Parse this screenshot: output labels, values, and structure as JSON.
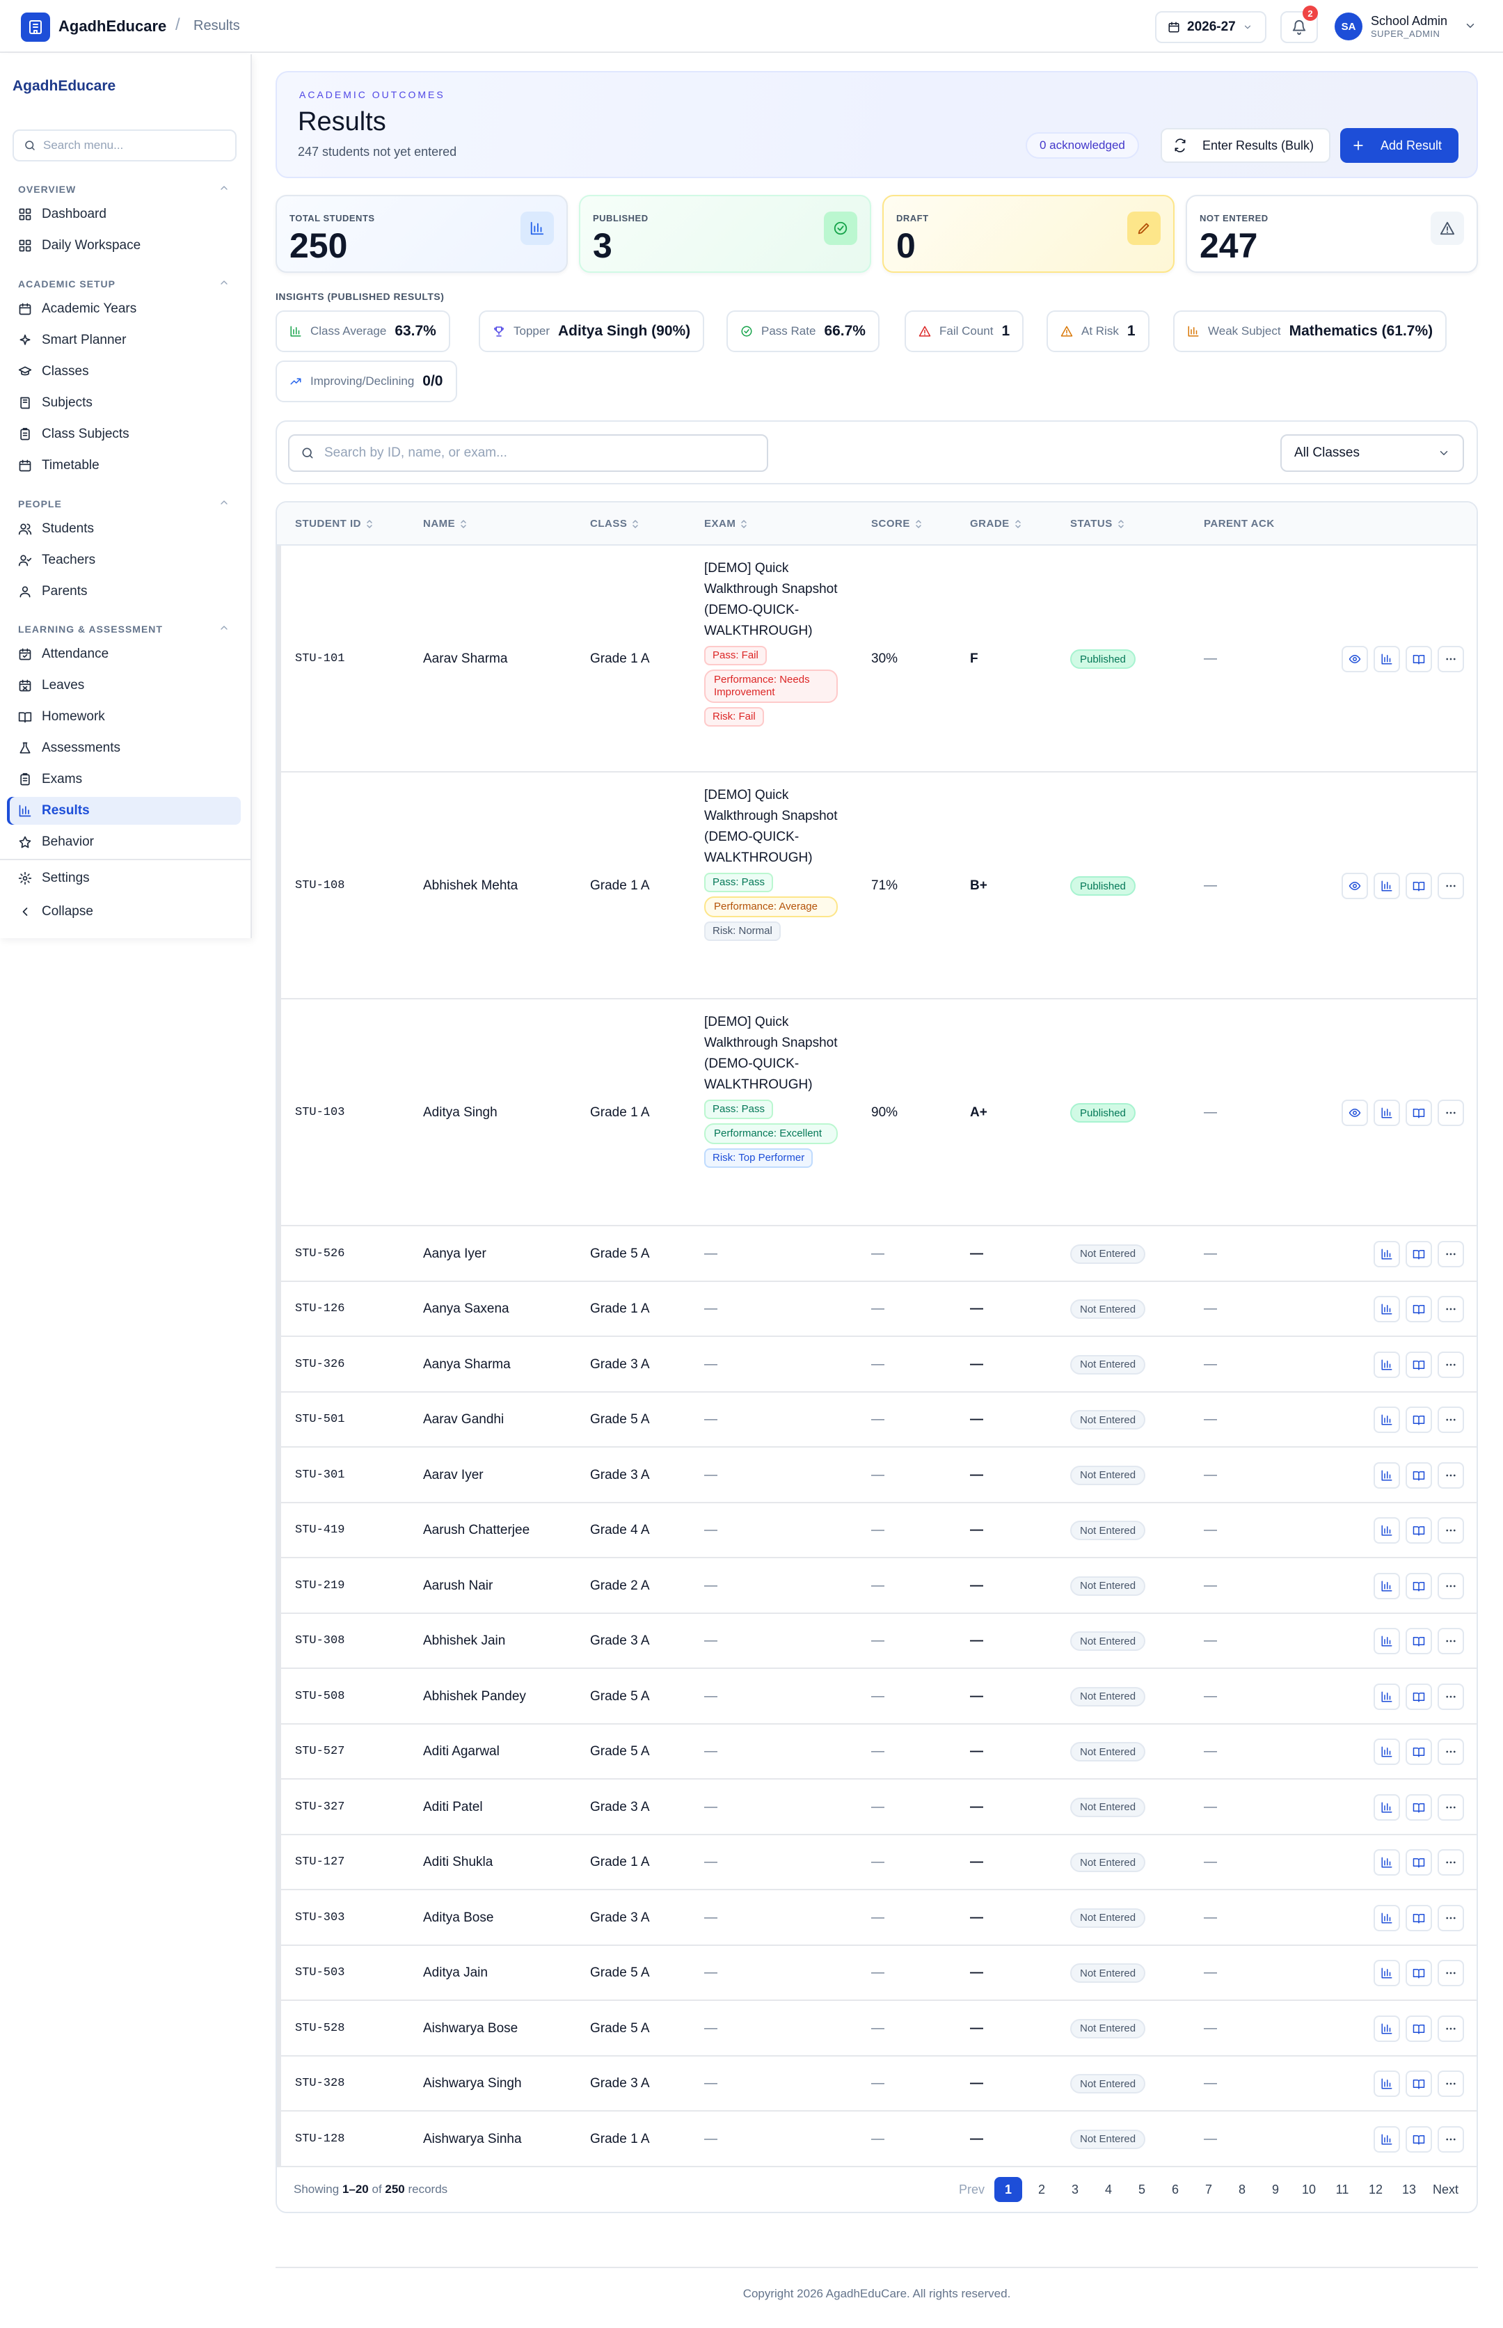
{
  "topbar": {
    "brand": "AgadhEducare",
    "breadcrumb_sep": "/",
    "breadcrumb": "Results",
    "year": "2026-27",
    "notification_count": "2",
    "avatar_initials": "SA",
    "user_name": "School Admin",
    "user_role": "SUPER_ADMIN"
  },
  "sidebar": {
    "brand": "AgadhEducare",
    "search_placeholder": "Search menu...",
    "sections": [
      {
        "title": "OVERVIEW",
        "items": [
          {
            "label": "Dashboard",
            "icon": "grid-icon"
          },
          {
            "label": "Daily Workspace",
            "icon": "grid-icon"
          }
        ]
      },
      {
        "title": "ACADEMIC SETUP",
        "items": [
          {
            "label": "Academic Years",
            "icon": "calendar-icon"
          },
          {
            "label": "Smart Planner",
            "icon": "sparkle-icon"
          },
          {
            "label": "Classes",
            "icon": "graduation-cap-icon"
          },
          {
            "label": "Subjects",
            "icon": "book-icon"
          },
          {
            "label": "Class Subjects",
            "icon": "clipboard-icon"
          },
          {
            "label": "Timetable",
            "icon": "calendar-icon"
          }
        ]
      },
      {
        "title": "PEOPLE",
        "items": [
          {
            "label": "Students",
            "icon": "users-icon"
          },
          {
            "label": "Teachers",
            "icon": "user-check-icon"
          },
          {
            "label": "Parents",
            "icon": "user-icon"
          }
        ]
      },
      {
        "title": "LEARNING & ASSESSMENT",
        "items": [
          {
            "label": "Attendance",
            "icon": "calendar-check-icon"
          },
          {
            "label": "Leaves",
            "icon": "calendar-off-icon"
          },
          {
            "label": "Homework",
            "icon": "book-open-icon"
          },
          {
            "label": "Assessments",
            "icon": "flask-icon"
          },
          {
            "label": "Exams",
            "icon": "clipboard-icon"
          },
          {
            "label": "Results",
            "icon": "bar-chart-icon"
          },
          {
            "label": "Behavior",
            "icon": "star-icon"
          }
        ]
      }
    ],
    "active": "Results",
    "settings": "Settings",
    "collapse": "Collapse"
  },
  "hero": {
    "eyebrow": "ACADEMIC OUTCOMES",
    "title": "Results",
    "subtitle": "247 students not yet entered",
    "ack": "0 acknowledged",
    "bulk_button": "Enter Results (Bulk)",
    "add_button": "Add Result"
  },
  "stats": [
    {
      "label": "TOTAL STUDENTS",
      "value": "250",
      "icon": "bar-chart-icon",
      "color": "#2563eb"
    },
    {
      "label": "PUBLISHED",
      "value": "3",
      "icon": "check-circle-icon",
      "color": "#16a34a"
    },
    {
      "label": "DRAFT",
      "value": "0",
      "icon": "pencil-icon",
      "color": "#b45309"
    },
    {
      "label": "NOT ENTERED",
      "value": "247",
      "icon": "alert-triangle-icon",
      "color": "#475569"
    }
  ],
  "insights": {
    "title": "INSIGHTS (PUBLISHED RESULTS)",
    "chips": [
      {
        "label": "Class Average",
        "value": "63.7%"
      },
      {
        "label": "Topper",
        "value": "Aditya Singh (90%)"
      },
      {
        "label": "Pass Rate",
        "value": "66.7%"
      },
      {
        "label": "Fail Count",
        "value": "1"
      },
      {
        "label": "At Risk",
        "value": "1"
      },
      {
        "label": "Weak Subject",
        "value": "Mathematics (61.7%)"
      },
      {
        "label": "Improving/Declining",
        "value": "0/0"
      }
    ]
  },
  "filter": {
    "search_placeholder": "Search by ID, name, or exam...",
    "class_select": "All Classes"
  },
  "table": {
    "headers": [
      "STUDENT ID",
      "NAME",
      "CLASS",
      "EXAM",
      "SCORE",
      "GRADE",
      "STATUS",
      "PARENT ACK"
    ],
    "detailed_rows": [
      {
        "id": "STU-101",
        "name": "Aarav Sharma",
        "class": "Grade 1 A",
        "exam": "[DEMO] Quick Walkthrough Snapshot (DEMO-QUICK-WALKTHROUGH)",
        "pass": "Pass: Fail",
        "performance": "Performance: Needs Improvement",
        "risk": "Risk: Fail",
        "score": "30%",
        "grade": "F",
        "status": "Published",
        "ack": "—"
      },
      {
        "id": "STU-108",
        "name": "Abhishek Mehta",
        "class": "Grade 1 A",
        "exam": "[DEMO] Quick Walkthrough Snapshot (DEMO-QUICK-WALKTHROUGH)",
        "pass": "Pass: Pass",
        "performance": "Performance: Average",
        "risk": "Risk: Normal",
        "score": "71%",
        "grade": "B+",
        "status": "Published",
        "ack": "—"
      },
      {
        "id": "STU-103",
        "name": "Aditya Singh",
        "class": "Grade 1 A",
        "exam": "[DEMO] Quick Walkthrough Snapshot (DEMO-QUICK-WALKTHROUGH)",
        "pass": "Pass: Pass",
        "performance": "Performance: Excellent",
        "risk": "Risk: Top Performer",
        "score": "90%",
        "grade": "A+",
        "status": "Published",
        "ack": "—"
      }
    ],
    "empty_rows": [
      {
        "id": "STU-526",
        "name": "Aanya Iyer",
        "class": "Grade 5 A"
      },
      {
        "id": "STU-126",
        "name": "Aanya Saxena",
        "class": "Grade 1 A"
      },
      {
        "id": "STU-326",
        "name": "Aanya Sharma",
        "class": "Grade 3 A"
      },
      {
        "id": "STU-501",
        "name": "Aarav Gandhi",
        "class": "Grade 5 A"
      },
      {
        "id": "STU-301",
        "name": "Aarav Iyer",
        "class": "Grade 3 A"
      },
      {
        "id": "STU-419",
        "name": "Aarush Chatterjee",
        "class": "Grade 4 A"
      },
      {
        "id": "STU-219",
        "name": "Aarush Nair",
        "class": "Grade 2 A"
      },
      {
        "id": "STU-308",
        "name": "Abhishek Jain",
        "class": "Grade 3 A"
      },
      {
        "id": "STU-508",
        "name": "Abhishek Pandey",
        "class": "Grade 5 A"
      },
      {
        "id": "STU-527",
        "name": "Aditi Agarwal",
        "class": "Grade 5 A"
      },
      {
        "id": "STU-327",
        "name": "Aditi Patel",
        "class": "Grade 3 A"
      },
      {
        "id": "STU-127",
        "name": "Aditi Shukla",
        "class": "Grade 1 A"
      },
      {
        "id": "STU-303",
        "name": "Aditya Bose",
        "class": "Grade 3 A"
      },
      {
        "id": "STU-503",
        "name": "Aditya Jain",
        "class": "Grade 5 A"
      },
      {
        "id": "STU-528",
        "name": "Aishwarya Bose",
        "class": "Grade 5 A"
      },
      {
        "id": "STU-328",
        "name": "Aishwarya Singh",
        "class": "Grade 3 A"
      },
      {
        "id": "STU-128",
        "name": "Aishwarya Sinha",
        "class": "Grade 1 A"
      }
    ],
    "empty_value": "—",
    "not_entered": "Not Entered",
    "showing": {
      "prefix": "Showing ",
      "range": "1–20",
      "of": " of ",
      "total": "250",
      "suffix": " records"
    },
    "pager": {
      "prev": "Prev",
      "pages": [
        "1",
        "2",
        "3",
        "4",
        "5",
        "6",
        "7",
        "8",
        "9",
        "10",
        "11",
        "12",
        "13"
      ],
      "next": "Next"
    }
  },
  "footer": {
    "copyright": "Copyright 2026 AgadhEduCare. All rights reserved."
  }
}
